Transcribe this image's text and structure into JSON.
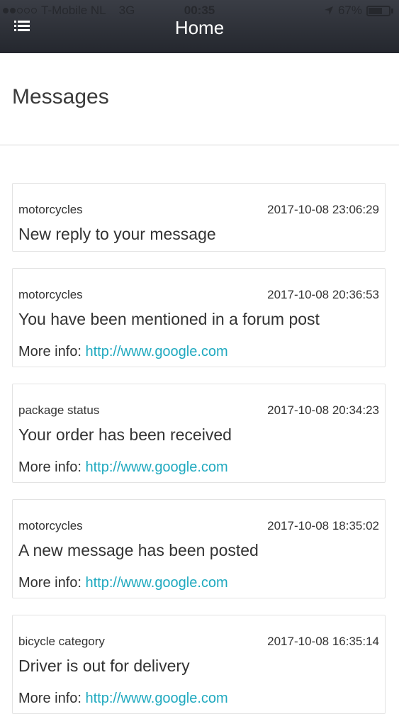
{
  "status_bar": {
    "carrier": "T-Mobile NL",
    "network": "3G",
    "time": "00:35",
    "battery": "67%",
    "battery_level": 0.67
  },
  "header": {
    "title": "Home",
    "menu_icon": "list-menu-icon"
  },
  "page": {
    "title": "Messages"
  },
  "messages": [
    {
      "category": "motorcycles",
      "timestamp": "2017-10-08 23:06:29",
      "title": "New reply to your message",
      "more_label": "",
      "link": ""
    },
    {
      "category": "motorcycles",
      "timestamp": "2017-10-08 20:36:53",
      "title": "You have been mentioned in a forum post",
      "more_label": "More info:",
      "link": "http://www.google.com"
    },
    {
      "category": "package status",
      "timestamp": "2017-10-08 20:34:23",
      "title": "Your order has been received",
      "more_label": "More info:",
      "link": "http://www.google.com"
    },
    {
      "category": "motorcycles",
      "timestamp": "2017-10-08 18:35:02",
      "title": "A new message has been posted",
      "more_label": "More info:",
      "link": "http://www.google.com"
    },
    {
      "category": "bicycle category",
      "timestamp": "2017-10-08 16:35:14",
      "title": "Driver is out for delivery",
      "more_label": "More info:",
      "link": "http://www.google.com"
    }
  ],
  "colors": {
    "header": "#24272e",
    "link": "#1fa9bf",
    "border": "#e3e3e3"
  }
}
